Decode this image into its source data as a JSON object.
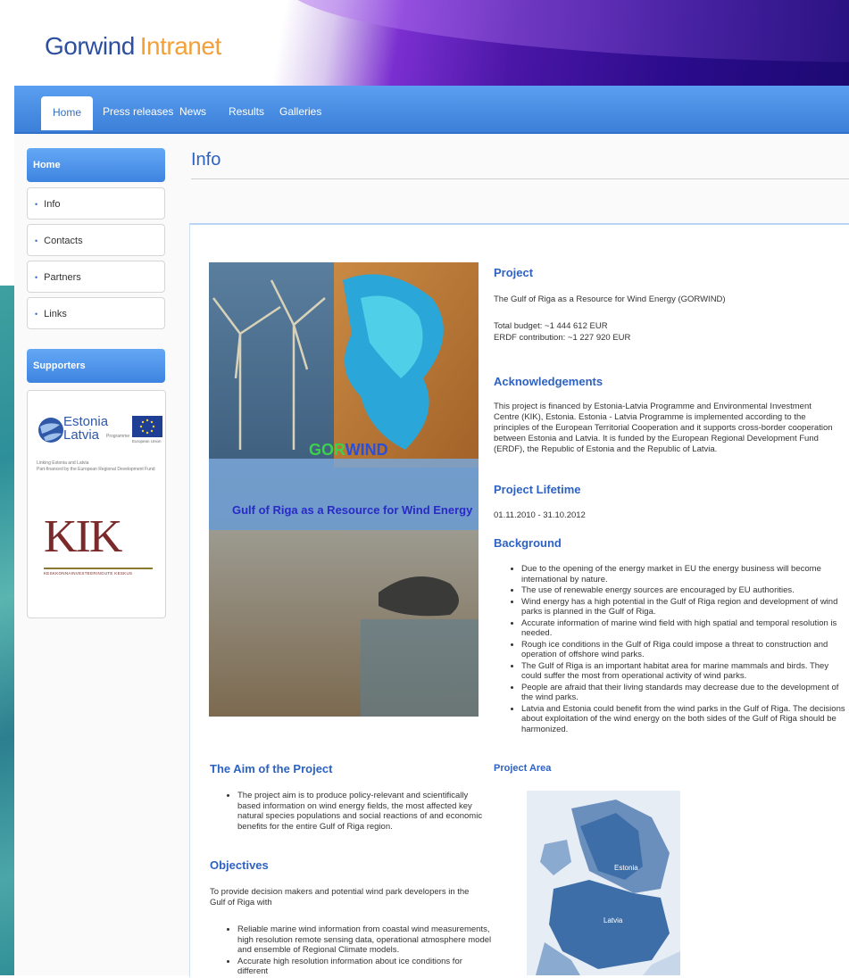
{
  "header": {
    "logo_main": "Gorwind",
    "logo_accent": "Intranet"
  },
  "nav": {
    "tabs": [
      "Home",
      "Press releases",
      "News",
      "Results",
      "Galleries"
    ]
  },
  "sidebar": {
    "home_label": "Home",
    "items": [
      "Info",
      "Contacts",
      "Partners",
      "Links"
    ],
    "supporters_label": "Supporters",
    "estonia_latvia": {
      "line1": "Estonia",
      "line2": "Latvia",
      "programme": "Programme",
      "eu_caption": "European Union",
      "small1": "Linking Estonia and Latvia",
      "small2": "Part-financed by the European Regional Development Fund"
    },
    "kik": {
      "letters": "KIK",
      "caption": "KESKKONNAINVESTEERINGUTE KESKUS"
    }
  },
  "main": {
    "page_title": "Info",
    "poster": {
      "title_green": "GOR",
      "title_blue": "WIND",
      "subtitle": "Gulf of Riga as a Resource for Wind Energy"
    },
    "project": {
      "heading": "Project",
      "name": "The Gulf of Riga as a Resource for Wind Energy (GORWIND)",
      "budget": "Total budget: ~1 444 612 EUR",
      "erdf": "ERDF contribution: ~1 227 920 EUR"
    },
    "acknowledgements": {
      "heading": "Acknowledgements",
      "text": "This project is financed by Estonia-Latvia Programme and Environmental Investment Centre (KIK), Estonia. Estonia - Latvia Programme is implemented according to the principles of the European Territorial Cooperation and it supports cross-border cooperation between Estonia and Latvia. It is funded by the European Regional Development Fund (ERDF), the Republic of Estonia and the Republic of Latvia."
    },
    "lifetime": {
      "heading": "Project Lifetime",
      "dates": "01.11.2010 - 31.10.2012"
    },
    "background": {
      "heading": "Background",
      "items": [
        "Due to the opening of the energy market in EU the energy business will become international by nature.",
        "The use of renewable energy sources are encouraged by EU authorities.",
        "Wind energy has a high potential in the Gulf of Riga region and development of wind parks is planned in the Gulf of Riga.",
        "Accurate information of marine wind field with high spatial and temporal resolution is needed.",
        "Rough ice conditions in the Gulf of Riga could impose a threat to construction and operation of offshore wind parks.",
        "The Gulf of Riga is an important habitat area for marine mammals and birds. They could suffer the most from operational activity of wind parks.",
        "People are afraid that their living standards may decrease due to the development of the wind parks.",
        "Latvia and Estonia could benefit from the wind parks in the Gulf of Riga. The decisions about exploitation of the wind energy on the both sides of the Gulf of Riga should be harmonized."
      ]
    },
    "project_area": {
      "heading": "Project Area",
      "label_estonia": "Estonia",
      "label_latvia": "Latvia"
    },
    "aim": {
      "heading": "The Aim of the Project",
      "items": [
        "The project aim is to produce policy-relevant and scientifically based information on wind energy fields, the most affected key natural species populations and social reactions of and economic benefits for the entire Gulf of Riga region."
      ]
    },
    "objectives": {
      "heading": "Objectives",
      "intro": "To provide decision makers and potential wind park developers in the Gulf of Riga with",
      "items": [
        "Reliable marine wind information from coastal wind measurements, high resolution remote sensing data, operational atmosphere model and ensemble of Regional Climate models.",
        "Accurate high resolution information about ice conditions for different"
      ]
    }
  }
}
